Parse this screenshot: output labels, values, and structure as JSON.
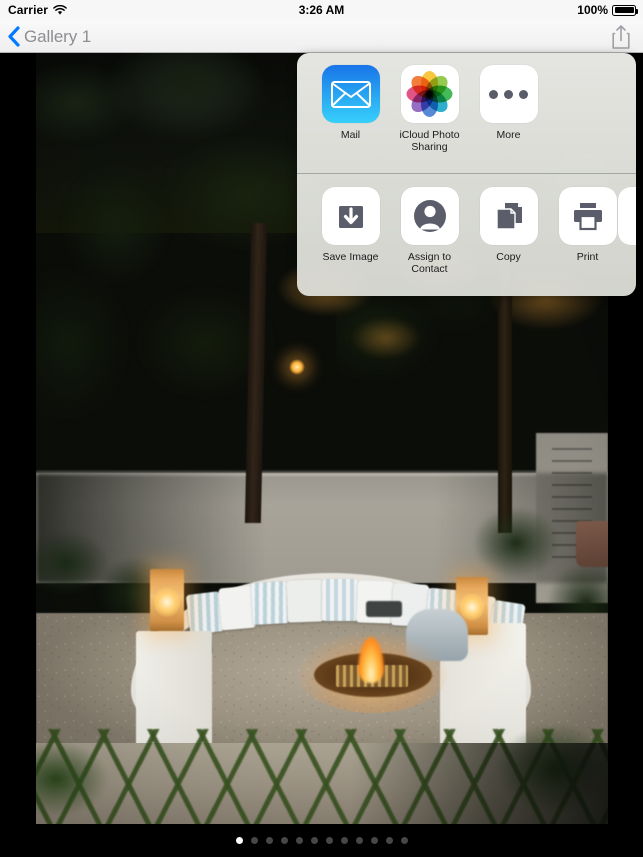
{
  "status_bar": {
    "carrier": "Carrier",
    "wifi_icon": "wifi-icon",
    "time": "3:26 AM",
    "battery_percent": "100%",
    "battery_icon": "battery-full-icon"
  },
  "nav_bar": {
    "back_icon": "chevron-left-icon",
    "back_label": "Gallery 1",
    "share_icon": "share-icon",
    "accent_color": "#007aff",
    "back_label_color": "#8e8e93"
  },
  "share_sheet": {
    "apps": [
      {
        "label": "Mail",
        "icon": "mail-icon"
      },
      {
        "label": "iCloud Photo Sharing",
        "icon": "photos-flower-icon"
      },
      {
        "label": "More",
        "icon": "more-dots-icon"
      }
    ],
    "actions": [
      {
        "label": "Save Image",
        "icon": "save-image-icon"
      },
      {
        "label": "Assign to Contact",
        "icon": "assign-to-contact-icon"
      },
      {
        "label": "Copy",
        "icon": "copy-icon"
      },
      {
        "label": "Print",
        "icon": "print-icon"
      },
      {
        "label": "",
        "icon": "partial-icon"
      }
    ],
    "icon_gray": "#5b5e6a"
  },
  "photo": {
    "description": "Night-time backyard patio with curved white bench seating, striped and white cushions, lit lanterns, a sunken fire pit, gravel ground and grass-jointed stone pavers beneath dark trees"
  },
  "page_control": {
    "total": 12,
    "current": 1
  }
}
